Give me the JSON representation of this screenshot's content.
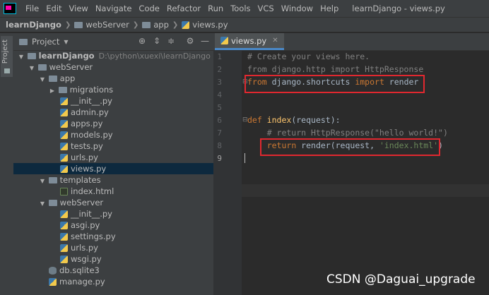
{
  "menubar": {
    "items": [
      "File",
      "Edit",
      "View",
      "Navigate",
      "Code",
      "Refactor",
      "Run",
      "Tools",
      "VCS",
      "Window",
      "Help"
    ],
    "window_title": "learnDjango - views.py"
  },
  "breadcrumb": {
    "items": [
      "learnDjango",
      "webServer",
      "app",
      "views.py"
    ]
  },
  "sidebar": {
    "project_tab": "Project"
  },
  "project_panel": {
    "title": "Project",
    "tree": [
      {
        "label": "learnDjango",
        "hint": "D:\\python\\xuexi\\learnDjango",
        "kind": "folder",
        "expanded": true
      },
      {
        "label": "webServer",
        "kind": "folder",
        "expanded": true
      },
      {
        "label": "app",
        "kind": "folder",
        "expanded": true
      },
      {
        "label": "migrations",
        "kind": "folder",
        "expanded": false
      },
      {
        "label": "__init__.py",
        "kind": "py"
      },
      {
        "label": "admin.py",
        "kind": "py"
      },
      {
        "label": "apps.py",
        "kind": "py"
      },
      {
        "label": "models.py",
        "kind": "py"
      },
      {
        "label": "tests.py",
        "kind": "py"
      },
      {
        "label": "urls.py",
        "kind": "py"
      },
      {
        "label": "views.py",
        "kind": "py",
        "selected": true
      },
      {
        "label": "templates",
        "kind": "folder",
        "expanded": true
      },
      {
        "label": "index.html",
        "kind": "html"
      },
      {
        "label": "webServer",
        "kind": "folder",
        "expanded": true
      },
      {
        "label": "__init__.py",
        "kind": "py"
      },
      {
        "label": "asgi.py",
        "kind": "py"
      },
      {
        "label": "settings.py",
        "kind": "py"
      },
      {
        "label": "urls.py",
        "kind": "py"
      },
      {
        "label": "wsgi.py",
        "kind": "py"
      },
      {
        "label": "db.sqlite3",
        "kind": "db"
      },
      {
        "label": "manage.py",
        "kind": "py"
      }
    ]
  },
  "editor": {
    "tab_label": "views.py",
    "lines": [
      "1",
      "2",
      "3",
      "4",
      "5",
      "6",
      "7",
      "8",
      "9"
    ],
    "code": {
      "l1": "# Create your views here.",
      "l2": "from django.http import HttpResponse",
      "l3_from": "from",
      "l3_mod": " django.shortcuts ",
      "l3_import": "import",
      "l3_name": " render",
      "l6_def": "def",
      "l6_name": " index",
      "l6_rest": "(request):",
      "l7": "    # return HttpResponse(\"hello world!\")",
      "l8_indent": "    ",
      "l8_return": "return",
      "l8_call": " render(request, ",
      "l8_str": "'index.html'",
      "l8_end": ")"
    }
  },
  "watermark": "CSDN @Daguai_upgrade",
  "colors": {
    "keyword": "#cc7832",
    "comment": "#808080",
    "function": "#ffc66d",
    "string": "#6a8759",
    "highlight_box": "#e0282f"
  }
}
